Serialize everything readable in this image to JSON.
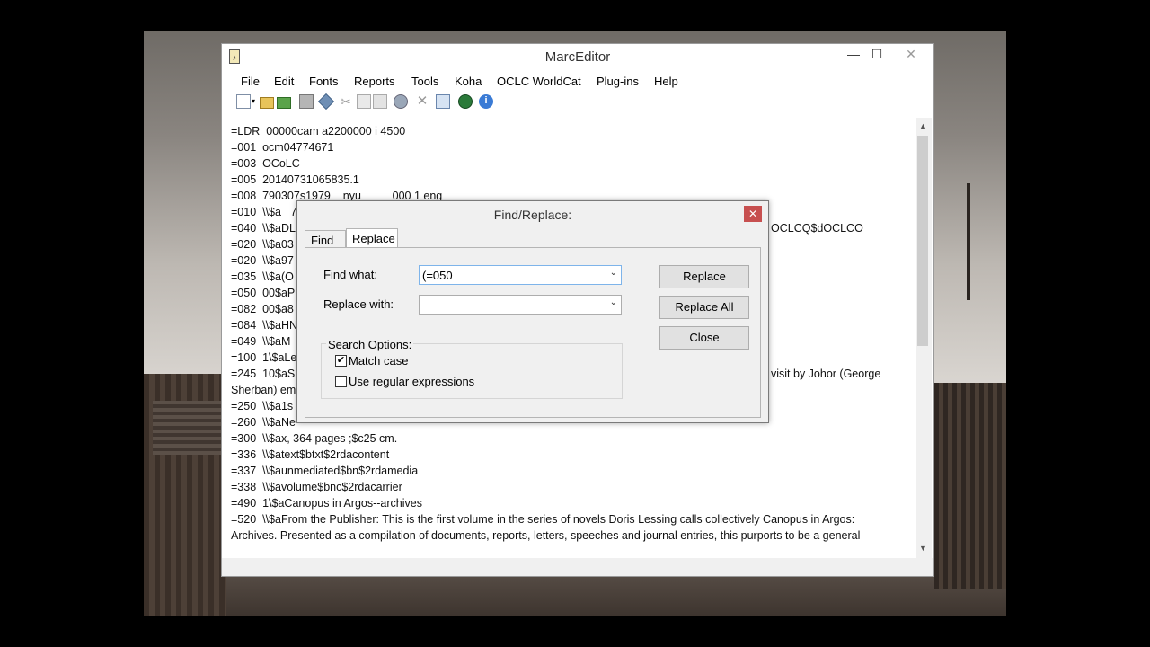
{
  "window": {
    "title": "MarcEditor",
    "icon_glyph": "♪",
    "controls": {
      "minimize": "—",
      "maximize": "☐",
      "close": "✕"
    }
  },
  "menu": [
    "File",
    "Edit",
    "Fonts",
    "Reports",
    "Tools",
    "Koha",
    "OCLC WorldCat",
    "Plug-ins",
    "Help"
  ],
  "toolbar_icons": [
    "new-icon",
    "dropdown-icon",
    "open-icon",
    "save-icon",
    "print-icon",
    "validate-icon",
    "cut-icon",
    "copy-icon",
    "paste-icon",
    "find-icon",
    "delete-icon",
    "report-icon",
    "globe-icon",
    "info-icon"
  ],
  "editor": {
    "lines": [
      "=LDR  00000cam a2200000 i 4500",
      "=001  ocm04774671",
      "=003  OCoLC",
      "=005  20140731065835.1",
      "=008  790307s1979    nyu          000 1 eng",
      "=010  \\\\$a   7",
      "=040  \\\\$aDL",
      "=020  \\\\$a03",
      "=020  \\\\$a97",
      "=035  \\\\$a(O",
      "=050  00$aP",
      "=082  00$a8",
      "=084  \\\\$aHN",
      "=049  \\\\$aM",
      "=100  1\\$aLe",
      "=245  10$aS",
      "Sherban) em",
      "=250  \\\\$a1s",
      "=260  \\\\$aNe",
      "=300  \\\\$ax, 364 pages ;$c25 cm.",
      "=336  \\\\$atext$btxt$2rdacontent",
      "=337  \\\\$aunmediated$bn$2rdamedia",
      "=338  \\\\$avolume$bnc$2rdacarrier",
      "=490  1\\$aCanopus in Argos--archives",
      "=520  \\\\$aFrom the Publisher: This is the first volume in the series of novels Doris Lessing calls collectively Canopus in Argos:",
      "Archives. Presented as a compilation of documents, reports, letters, speeches and journal entries, this purports to be a general"
    ],
    "right_fragments": {
      "line_040": "OCLCQ$dOCLCO",
      "line_245": "visit by Johor (George"
    }
  },
  "dialog": {
    "title": "Find/Replace:",
    "close": "✕",
    "tabs": [
      "Find",
      "Replace"
    ],
    "active_tab": "Replace",
    "find_label": "Find what:",
    "find_value": "(=050",
    "replace_label": "Replace with:",
    "replace_value": "",
    "buttons": {
      "replace": "Replace",
      "replace_all": "Replace All",
      "close": "Close"
    },
    "options_label": "Search Options:",
    "match_case": {
      "label": "Match case",
      "checked": true,
      "mark": "✔"
    },
    "regex": {
      "label": "Use regular expressions",
      "checked": false,
      "mark": ""
    }
  }
}
